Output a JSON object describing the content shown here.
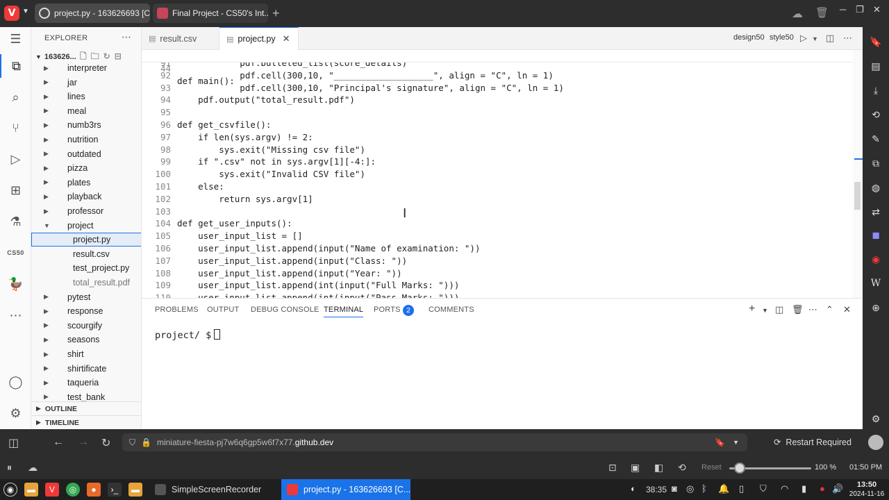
{
  "browser": {
    "tabs": [
      {
        "label": "project.py - 163626693 [Co"
      },
      {
        "label": "Final Project - CS50's Int..."
      }
    ],
    "new_tab": "+",
    "url_prefix": "miniature-fiesta-pj7w6q6gp5w6f7x77.",
    "url_host": "github.dev",
    "restart_label": "Restart Required",
    "zoom_reset": "Reset",
    "zoom_level": "100 %",
    "zoom_fraction": 0.13,
    "status_time": "01:50 PM"
  },
  "vscode": {
    "explorer_title": "EXPLORER",
    "workspace_folder": "163626...",
    "tree": [
      {
        "label": "interpreter",
        "type": "folder"
      },
      {
        "label": "jar",
        "type": "folder"
      },
      {
        "label": "lines",
        "type": "folder"
      },
      {
        "label": "meal",
        "type": "folder"
      },
      {
        "label": "numb3rs",
        "type": "folder"
      },
      {
        "label": "nutrition",
        "type": "folder"
      },
      {
        "label": "outdated",
        "type": "folder"
      },
      {
        "label": "pizza",
        "type": "folder"
      },
      {
        "label": "plates",
        "type": "folder"
      },
      {
        "label": "playback",
        "type": "folder"
      },
      {
        "label": "professor",
        "type": "folder"
      },
      {
        "label": "project",
        "type": "folder-open"
      },
      {
        "label": "project.py",
        "type": "file",
        "selected": true
      },
      {
        "label": "result.csv",
        "type": "file"
      },
      {
        "label": "test_project.py",
        "type": "file"
      },
      {
        "label": "total_result.pdf",
        "type": "file",
        "dim": true
      },
      {
        "label": "pytest",
        "type": "folder"
      },
      {
        "label": "response",
        "type": "folder"
      },
      {
        "label": "scourgify",
        "type": "folder"
      },
      {
        "label": "seasons",
        "type": "folder"
      },
      {
        "label": "shirt",
        "type": "folder"
      },
      {
        "label": "shirtificate",
        "type": "folder"
      },
      {
        "label": "taqueria",
        "type": "folder"
      },
      {
        "label": "test_bank",
        "type": "folder"
      }
    ],
    "outline_label": "OUTLINE",
    "timeline_label": "TIMELINE",
    "activity_cs50": "CS50",
    "editor_tabs": [
      {
        "label": "result.csv"
      },
      {
        "label": "project.py",
        "active": true
      }
    ],
    "design50": "design50",
    "style50": "style50",
    "sticky_line": {
      "num": "44",
      "text": "def main():"
    },
    "code_lines": [
      {
        "num": "91",
        "text": "            pdf.bulleted_list(score_details)"
      },
      {
        "num": "92",
        "text": "            pdf.cell(300,10, \"___________________\", align = \"C\", ln = 1)"
      },
      {
        "num": "93",
        "text": "            pdf.cell(300,10, \"Principal's signature\", align = \"C\", ln = 1)"
      },
      {
        "num": "94",
        "text": "    pdf.output(\"total_result.pdf\")"
      },
      {
        "num": "95",
        "text": ""
      },
      {
        "num": "96",
        "text": "def get_csvfile():"
      },
      {
        "num": "97",
        "text": "    if len(sys.argv) != 2:"
      },
      {
        "num": "98",
        "text": "        sys.exit(\"Missing csv file\")"
      },
      {
        "num": "99",
        "text": "    if \".csv\" not in sys.argv[1][-4:]:"
      },
      {
        "num": "100",
        "text": "        sys.exit(\"Invalid CSV file\")"
      },
      {
        "num": "101",
        "text": "    else:"
      },
      {
        "num": "102",
        "text": "        return sys.argv[1]"
      },
      {
        "num": "103",
        "text": ""
      },
      {
        "num": "104",
        "text": "def get_user_inputs():"
      },
      {
        "num": "105",
        "text": "    user_input_list = []"
      },
      {
        "num": "106",
        "text": "    user_input_list.append(input(\"Name of examination: \"))"
      },
      {
        "num": "107",
        "text": "    user_input_list.append(input(\"Class: \"))"
      },
      {
        "num": "108",
        "text": "    user_input_list.append(input(\"Year: \"))"
      },
      {
        "num": "109",
        "text": "    user_input_list.append(int(input(\"Full Marks: \")))"
      },
      {
        "num": "110",
        "text": "    user_input_list.append(int(input(\"Pass Marks: \")))"
      }
    ],
    "panel_tabs": [
      {
        "label": "PROBLEMS"
      },
      {
        "label": "OUTPUT"
      },
      {
        "label": "DEBUG CONSOLE"
      },
      {
        "label": "TERMINAL",
        "active": true
      },
      {
        "label": "PORTS"
      },
      {
        "label": "COMMENTS"
      }
    ],
    "ports_badge": "2",
    "terminal_prompt": "project/ $"
  },
  "taskbar": {
    "tasks": [
      {
        "label": "SimpleScreenRecorder"
      },
      {
        "label": "project.py - 163626693 [C...",
        "active": true
      }
    ],
    "tray_time": "38:35",
    "clock_time": "13:50",
    "clock_date": "2024-11-16"
  },
  "colors": {
    "accent": "#1f6feb",
    "vivaldi": "#ef3939",
    "taskbar_active": "#1a73e8"
  }
}
